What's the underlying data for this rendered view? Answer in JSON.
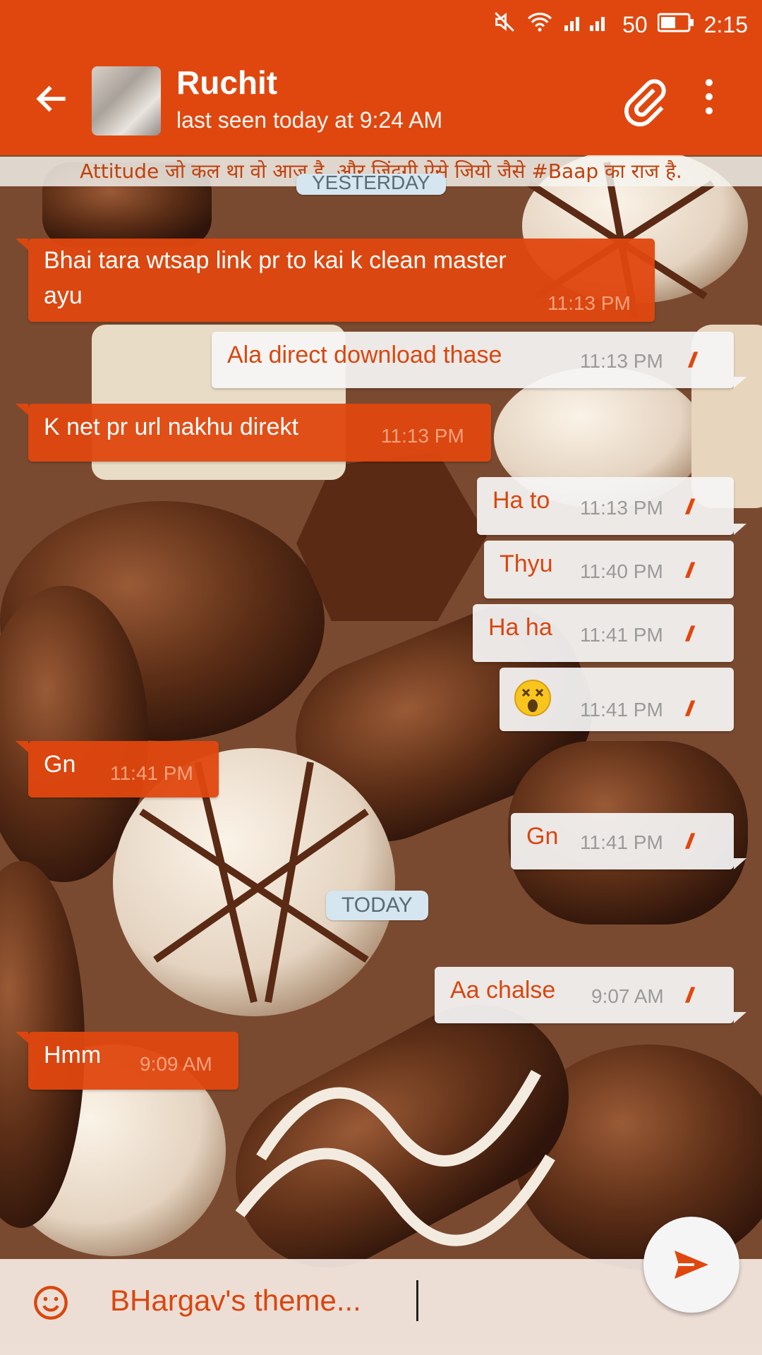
{
  "status_bar": {
    "signal_label": "50",
    "time": "2:15"
  },
  "header": {
    "contact_name": "Ruchit",
    "last_seen": "last seen today at 9:24 AM"
  },
  "ticker": "Attitude जो कल था वो आज है, और जिंदगी ऐसे जियो जैसे #Baap का राज है.",
  "date_chips": [
    "YESTERDAY",
    "TODAY"
  ],
  "messages": [
    {
      "dir": "in",
      "line1": "Bhai tara wtsap link pr to kai k clean master",
      "line2": "ayu",
      "time": "11:13 PM"
    },
    {
      "dir": "out",
      "text": "Ala direct download thase",
      "time": "11:13 PM"
    },
    {
      "dir": "in",
      "text": "K net pr url nakhu direkt",
      "time": "11:13 PM"
    },
    {
      "dir": "out",
      "text": "Ha to",
      "time": "11:13 PM"
    },
    {
      "dir": "out",
      "text": "Thyu",
      "time": "11:40 PM"
    },
    {
      "dir": "out",
      "text": "Ha ha",
      "time": "11:41 PM"
    },
    {
      "dir": "out",
      "text": "",
      "emoji": "dizzy-face",
      "time": "11:41 PM"
    },
    {
      "dir": "in",
      "text": "Gn",
      "time": "11:41 PM"
    },
    {
      "dir": "out",
      "text": "Gn",
      "time": "11:41 PM"
    },
    {
      "dir": "out",
      "text": "Aa chalse",
      "time": "9:07 AM"
    },
    {
      "dir": "in",
      "text": "Hmm",
      "time": "9:09 AM"
    }
  ],
  "read_ticks": "//",
  "composer": {
    "value": "BHargav's theme..."
  },
  "colors": {
    "accent": "#e0470f",
    "incoming_bubble": "#e0470f",
    "outgoing_bubble": "#f5f5f5",
    "date_chip": "#d6e6f0"
  },
  "icons": [
    "back-arrow-icon",
    "paperclip-icon",
    "more-vert-icon",
    "emoji-icon",
    "send-icon",
    "mute-icon",
    "wifi-icon",
    "signal-icon",
    "battery-icon"
  ]
}
